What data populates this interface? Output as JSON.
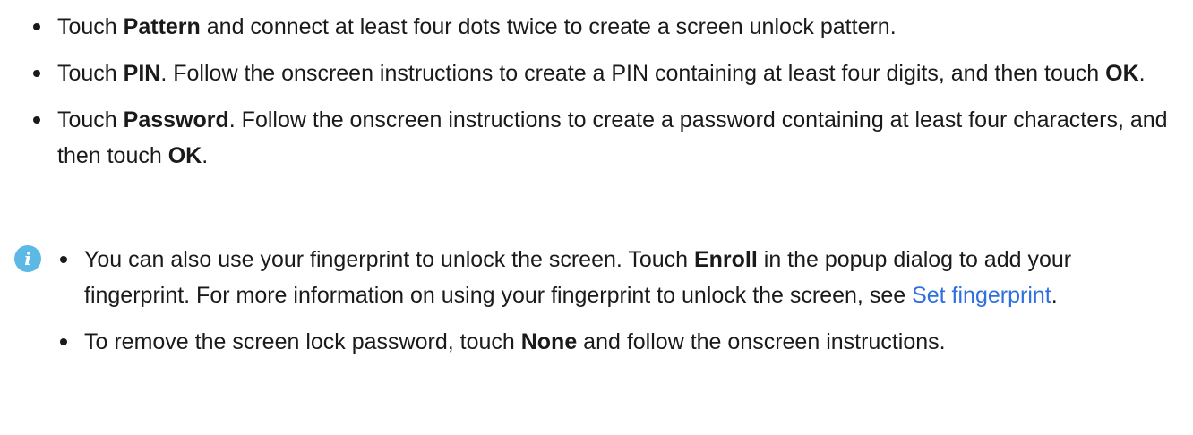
{
  "items": [
    {
      "pre": "Touch ",
      "bold": "Pattern",
      "post": " and connect at least four dots twice to create a screen unlock pattern."
    },
    {
      "pre": "Touch ",
      "bold": "PIN",
      "mid": ". Follow the onscreen instructions to create a PIN containing at least four digits, and then touch ",
      "bold2": "OK",
      "post": "."
    },
    {
      "pre": "Touch ",
      "bold": "Password",
      "mid": ". Follow the onscreen instructions to create a password containing at least four characters, and then touch ",
      "bold2": "OK",
      "post": "."
    }
  ],
  "note": {
    "icon": "info-icon",
    "icon_glyph": "i",
    "icon_color": "#5cb9e6",
    "items": [
      {
        "pre": "You can also use your fingerprint to unlock the screen. Touch ",
        "bold": "Enroll",
        "mid": " in the popup dialog to add your fingerprint. For more information on using your fingerprint to unlock the screen, see ",
        "link": "Set fingerprint",
        "post": "."
      },
      {
        "pre": "To remove the screen lock password, touch ",
        "bold": "None",
        "post": " and follow the onscreen instructions."
      }
    ]
  },
  "link_color": "#2f6fe0"
}
